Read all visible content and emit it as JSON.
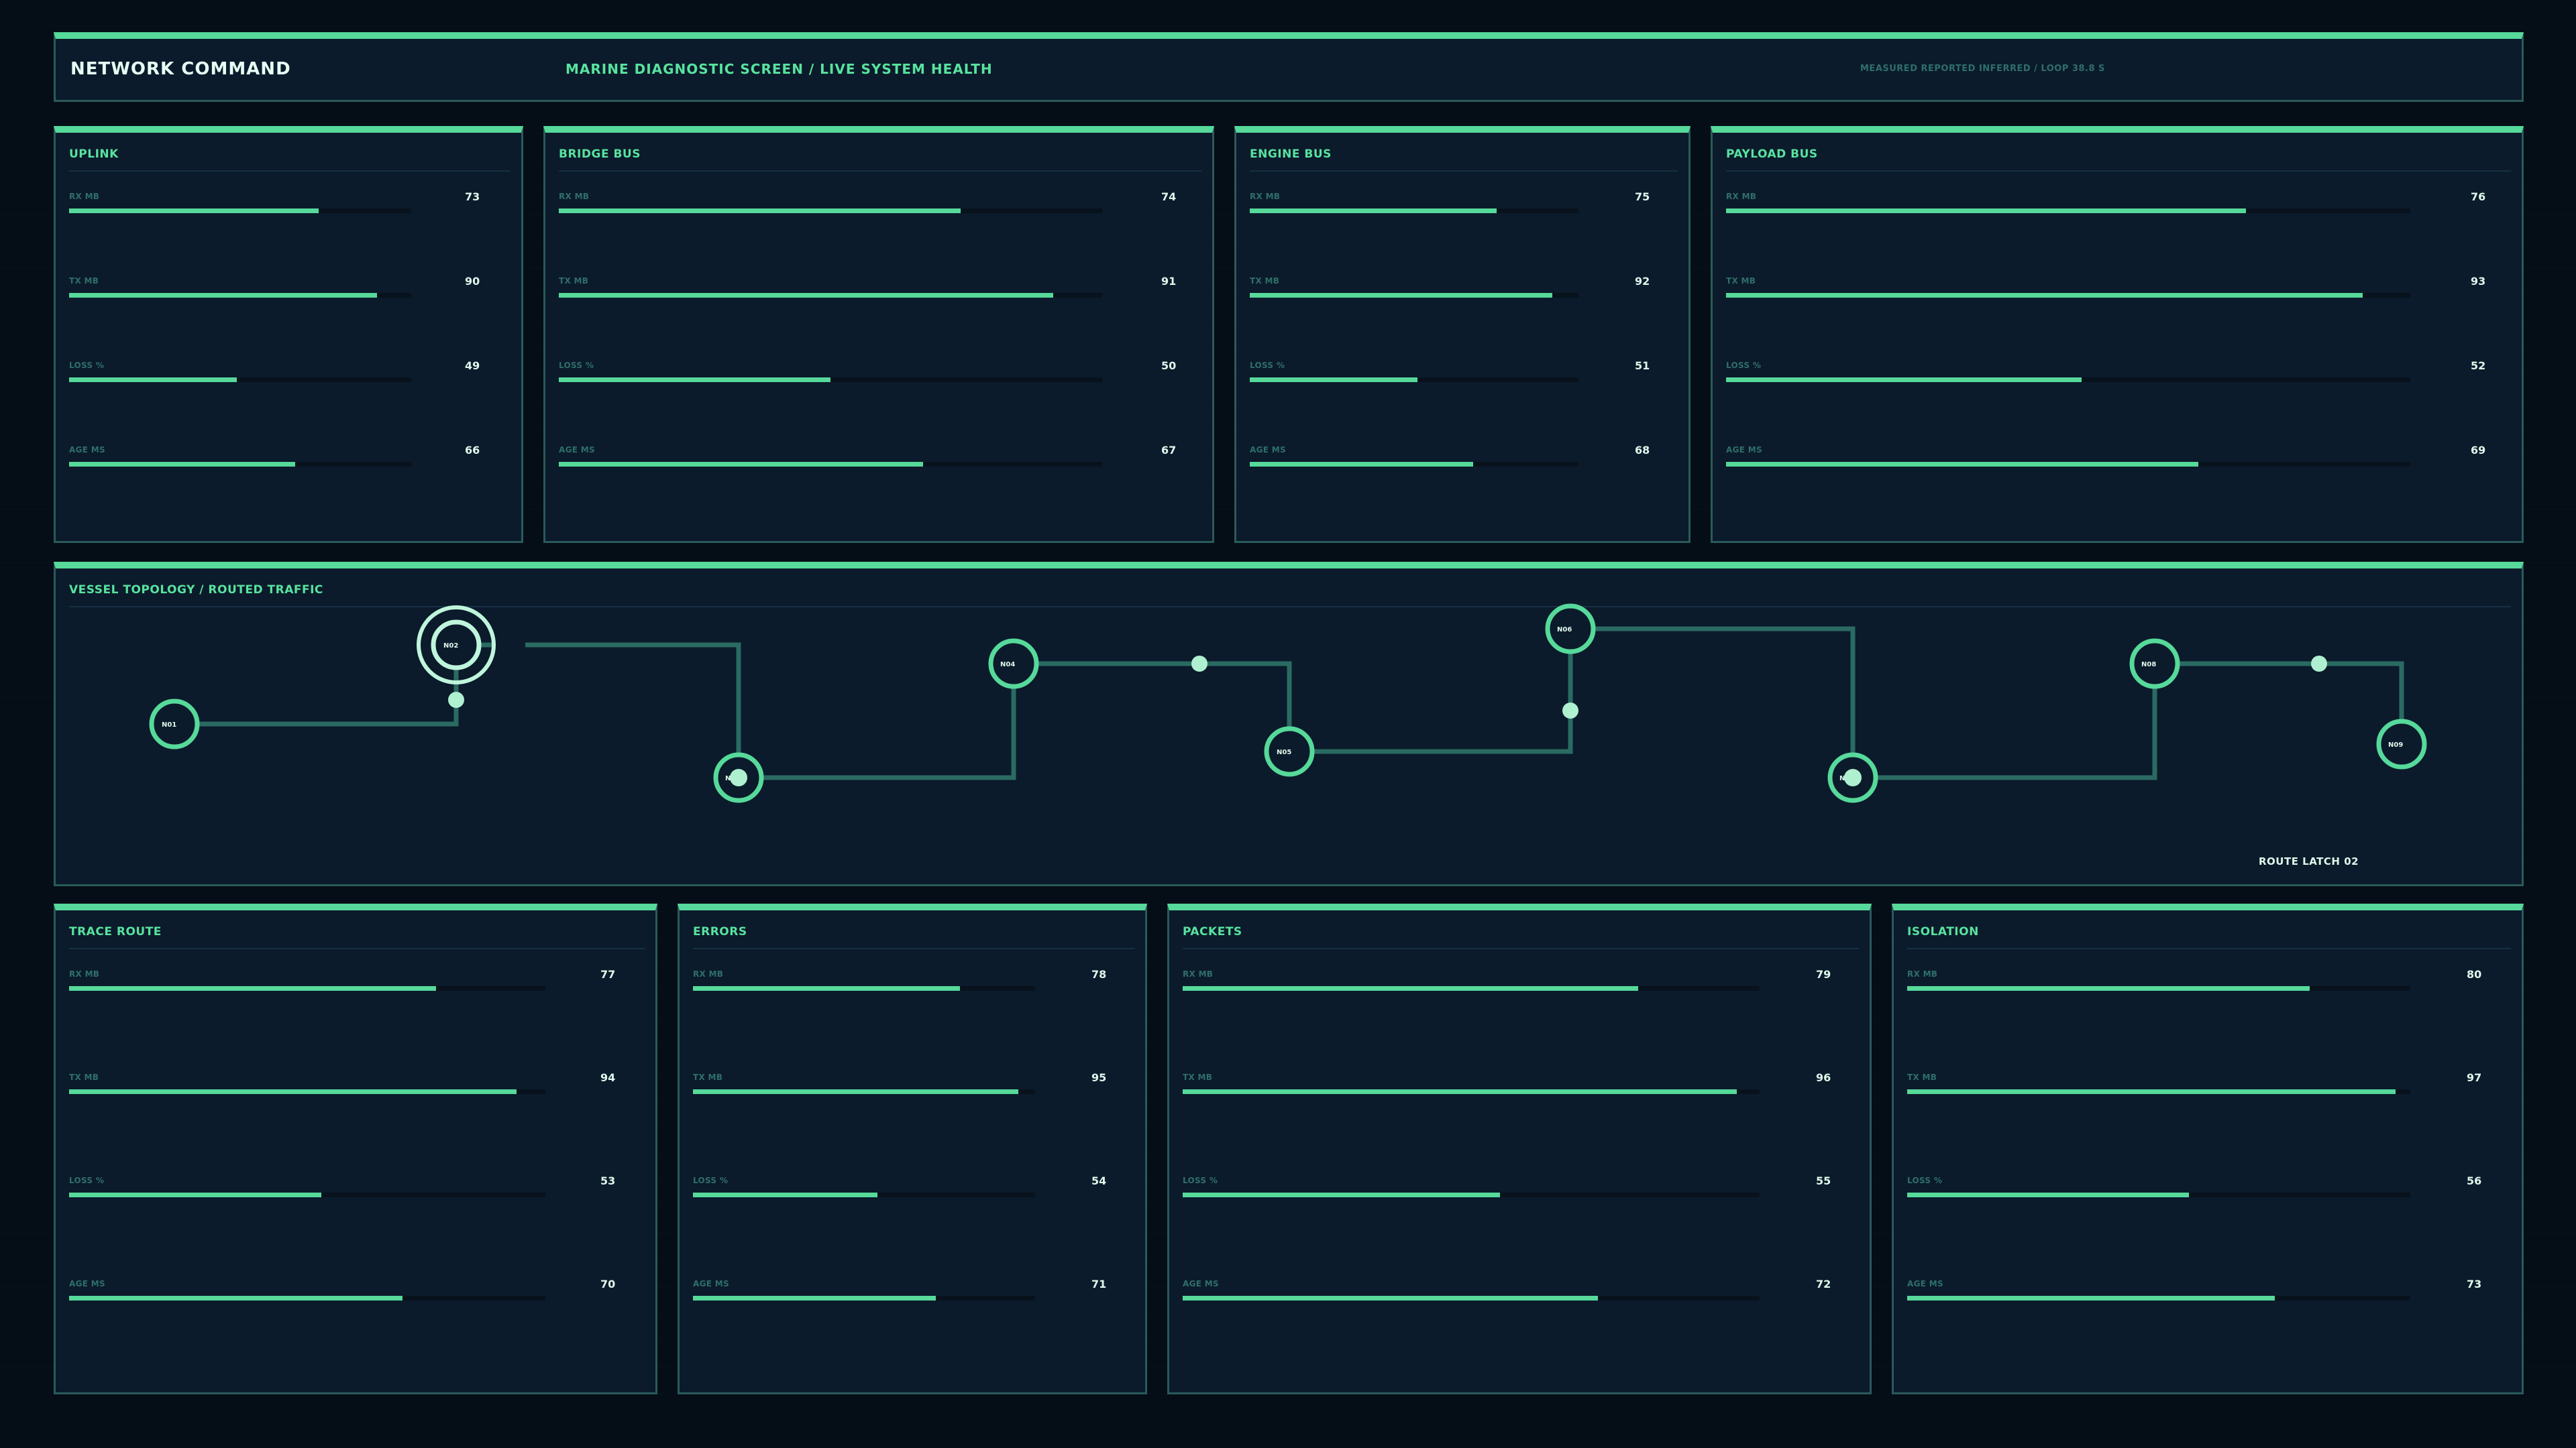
{
  "header": {
    "title": "NETWORK COMMAND",
    "subtitle": "MARINE DIAGNOSTIC SCREEN / LIVE SYSTEM HEALTH",
    "status": "MEASURED  REPORTED  INFERRED  /  LOOP 38.8 S"
  },
  "metric_labels": [
    "RX MB",
    "TX MB",
    "LOSS %",
    "AGE MS"
  ],
  "top_panels": [
    {
      "title": "UPLINK",
      "values": [
        73,
        90,
        49,
        66
      ]
    },
    {
      "title": "BRIDGE BUS",
      "values": [
        74,
        91,
        50,
        67
      ]
    },
    {
      "title": "ENGINE BUS",
      "values": [
        75,
        92,
        51,
        68
      ]
    },
    {
      "title": "PAYLOAD BUS",
      "values": [
        76,
        93,
        52,
        69
      ]
    }
  ],
  "topology": {
    "title": "VESSEL TOPOLOGY / ROUTED TRAFFIC",
    "nodes": [
      "N01",
      "N02",
      "N03",
      "N04",
      "N05",
      "N06",
      "N07",
      "N08",
      "N09"
    ],
    "route_label": "ROUTE LATCH 02"
  },
  "bottom_panels": [
    {
      "title": "TRACE ROUTE",
      "values": [
        77,
        94,
        53,
        70
      ]
    },
    {
      "title": "ERRORS",
      "values": [
        78,
        95,
        54,
        71
      ]
    },
    {
      "title": "PACKETS",
      "values": [
        79,
        96,
        55,
        72
      ]
    },
    {
      "title": "ISOLATION",
      "values": [
        80,
        97,
        56,
        73
      ]
    }
  ],
  "colors": {
    "accent": "#56d99a",
    "panel": "#0b1b2b",
    "background": "#050d17",
    "link": "#2a6a62",
    "value_text": "#dff8ec"
  }
}
